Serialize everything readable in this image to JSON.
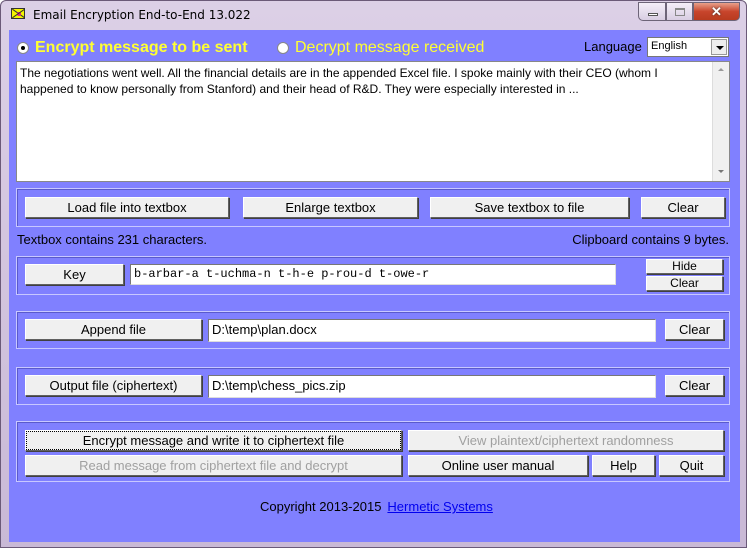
{
  "window": {
    "title": "Email Encryption End-to-End 13.022",
    "controls": {
      "minimize": "minimize",
      "maximize": "maximize",
      "close": "✕"
    }
  },
  "mode": {
    "encrypt_label": "Encrypt message to be sent",
    "decrypt_label": "Decrypt message received",
    "selected": "encrypt"
  },
  "language": {
    "label": "Language",
    "selected": "English"
  },
  "textbox": {
    "content": "The negotiations went well.  All the financial details are in the appended Excel file.  I spoke mainly with their CEO (whom I happened to know personally from Stanford) and their head of R&D.  They were especially interested in ..."
  },
  "textbox_buttons": {
    "load": "Load file into textbox",
    "enlarge": "Enlarge textbox",
    "save": "Save textbox to file",
    "clear": "Clear"
  },
  "status": {
    "textbox_count": "Textbox contains 231 characters.",
    "clipboard": "Clipboard contains 9 bytes."
  },
  "key": {
    "button": "Key",
    "value": "b-arbar-a t-uchma-n t-h-e p-rou-d t-owe-r",
    "hide": "Hide",
    "clear": "Clear"
  },
  "append": {
    "button": "Append file",
    "value": "D:\\temp\\plan.docx",
    "clear": "Clear"
  },
  "output": {
    "button": "Output file (ciphertext)",
    "value": "D:\\temp\\chess_pics.zip",
    "clear": "Clear"
  },
  "actions": {
    "encrypt": "Encrypt message and write it to ciphertext file",
    "view_randomness": "View plaintext/ciphertext randomness",
    "decrypt": "Read message from ciphertext file and decrypt",
    "manual": "Online user manual",
    "help": "Help",
    "quit": "Quit"
  },
  "footer": {
    "copyright": "Copyright 2013-2015",
    "link": "Hermetic Systems"
  },
  "colors": {
    "client_bg": "#8080ff",
    "radio_text": "#ffff33",
    "link": "#0000ee"
  }
}
